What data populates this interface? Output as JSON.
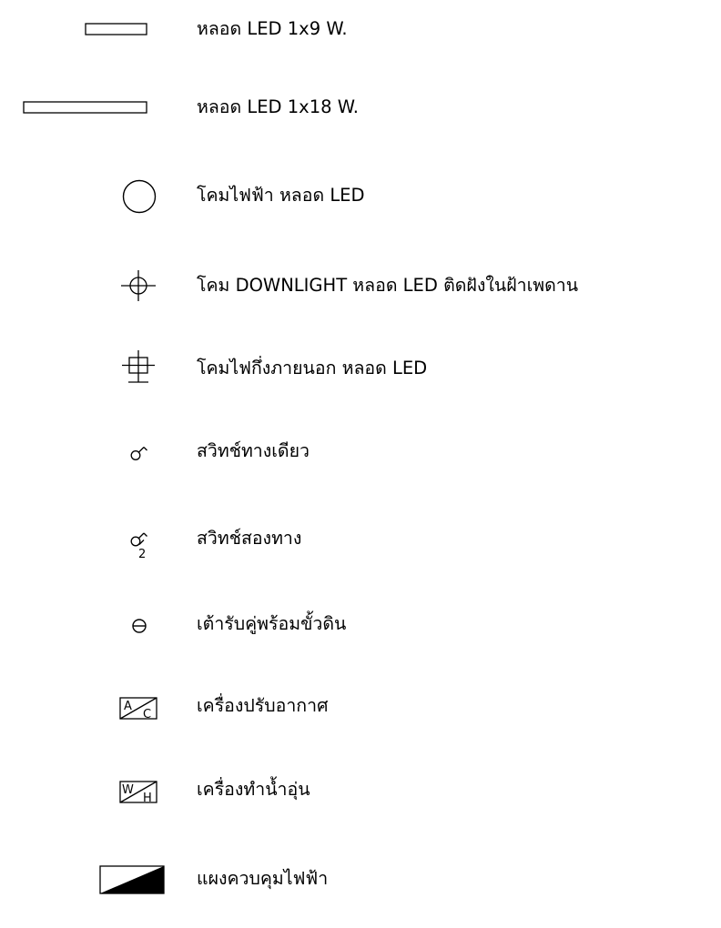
{
  "legend": {
    "items": [
      {
        "symbol": "led-1x9-rect-icon",
        "label": "หลอด LED 1x9 W."
      },
      {
        "symbol": "led-1x18-rect-icon",
        "label": "หลอด LED 1x18 W."
      },
      {
        "symbol": "circle-lamp-icon",
        "label": "โคมไฟฟ้า หลอด LED"
      },
      {
        "symbol": "downlight-icon",
        "label": "โคม DOWNLIGHT หลอด LED ติดฝังในฝ้าเพดาน"
      },
      {
        "symbol": "outdoor-lamp-icon",
        "label": "โคมไฟกึ่งภายนอก หลอด LED"
      },
      {
        "symbol": "single-way-switch-icon",
        "label": "สวิทช์ทางเดียว"
      },
      {
        "symbol": "two-way-switch-icon",
        "label": "สวิทช์สองทาง"
      },
      {
        "symbol": "grounded-outlet-icon",
        "label": "เต้ารับคู่พร้อมขั้วดิน"
      },
      {
        "symbol": "air-conditioner-icon",
        "label": "เครื่องปรับอากาศ"
      },
      {
        "symbol": "water-heater-icon",
        "label": "เครื่องทำน้ำอุ่น"
      },
      {
        "symbol": "distribution-panel-icon",
        "label": "แผงควบคุมไฟฟ้า"
      }
    ],
    "symbol_text": {
      "switch_two_way_sub": "2",
      "ac_top": "A",
      "ac_bottom": "C",
      "wh_top": "W",
      "wh_bottom": "H"
    }
  }
}
